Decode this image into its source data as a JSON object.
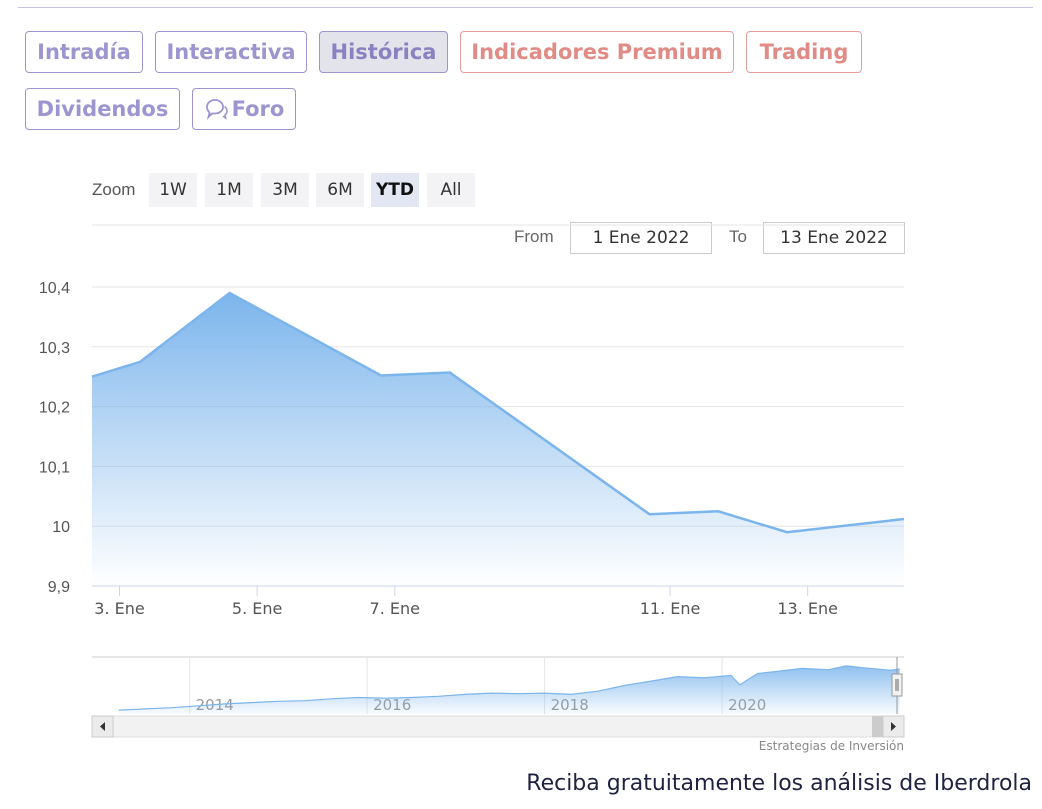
{
  "tabs": [
    {
      "label": "Intradía",
      "state": "normal"
    },
    {
      "label": "Interactiva",
      "state": "normal"
    },
    {
      "label": "Histórica",
      "state": "active"
    },
    {
      "label": "Indicadores Premium",
      "state": "premium"
    },
    {
      "label": "Trading",
      "state": "premium"
    },
    {
      "label": "Dividendos",
      "state": "normal"
    },
    {
      "label": "Foro",
      "state": "normal",
      "icon": "chat-bubbles-icon"
    }
  ],
  "zoom": {
    "label": "Zoom",
    "buttons": [
      "1W",
      "1M",
      "3M",
      "6M",
      "YTD",
      "All"
    ],
    "selected": "YTD"
  },
  "range": {
    "from_label": "From",
    "from_value": "1 Ene 2022",
    "to_label": "To",
    "to_value": "13 Ene 2022"
  },
  "colors": {
    "tab_border": "#9d95cf",
    "tab_active_bg": "#e3e3eb",
    "premium": "#e08b85",
    "series_line": "#7cb5ec",
    "area_top": "#7cb5ec",
    "grid": "#e6e6e6"
  },
  "chart_data": {
    "type": "area",
    "ylim": [
      9.9,
      10.4
    ],
    "yticks": [
      9.9,
      10,
      10.1,
      10.2,
      10.3,
      10.4
    ],
    "ytick_labels": [
      "9,9",
      "10",
      "10,1",
      "10,2",
      "10,3",
      "10,4"
    ],
    "xlim": [
      2.6,
      14.4
    ],
    "xticks": [
      3,
      5,
      7,
      11,
      13
    ],
    "xtick_labels": [
      "3. Ene",
      "5. Ene",
      "7. Ene",
      "11. Ene",
      "13. Ene"
    ],
    "x": [
      2.6,
      3.3,
      4.6,
      6.8,
      7.8,
      10.7,
      11.7,
      12.7,
      14.4
    ],
    "y": [
      10.25,
      10.275,
      10.39,
      10.252,
      10.257,
      10.02,
      10.025,
      9.99,
      10.012
    ],
    "grid": true,
    "legend": "none"
  },
  "navigator": {
    "year_labels": [
      "2014",
      "2016",
      "2018",
      "2020"
    ],
    "year_ticks": [
      2014,
      2016,
      2018,
      2020
    ],
    "xlim": [
      2012.9,
      2022.05
    ],
    "ylim": [
      3,
      12
    ],
    "x": [
      2013.2,
      2013.5,
      2013.8,
      2014.1,
      2014.4,
      2014.7,
      2015,
      2015.3,
      2015.6,
      2015.9,
      2016.2,
      2016.5,
      2016.8,
      2017.1,
      2017.4,
      2017.7,
      2018,
      2018.3,
      2018.6,
      2018.9,
      2019.2,
      2019.5,
      2019.8,
      2020.1,
      2020.2,
      2020.4,
      2020.6,
      2020.9,
      2021.2,
      2021.4,
      2021.6,
      2021.9,
      2022.0
    ],
    "y": [
      3.6,
      3.8,
      4,
      4.3,
      4.6,
      4.8,
      5,
      5.1,
      5.4,
      5.6,
      5.5,
      5.6,
      5.8,
      6.1,
      6.3,
      6.2,
      6.3,
      6.1,
      6.6,
      7.5,
      8.2,
      8.9,
      8.7,
      9.1,
      7.6,
      9.4,
      9.7,
      10.2,
      10.0,
      10.6,
      10.3,
      9.9,
      10.1
    ]
  },
  "credit": "Estrategias de Inversión",
  "promo": "Reciba gratuitamente los análisis de Iberdrola"
}
